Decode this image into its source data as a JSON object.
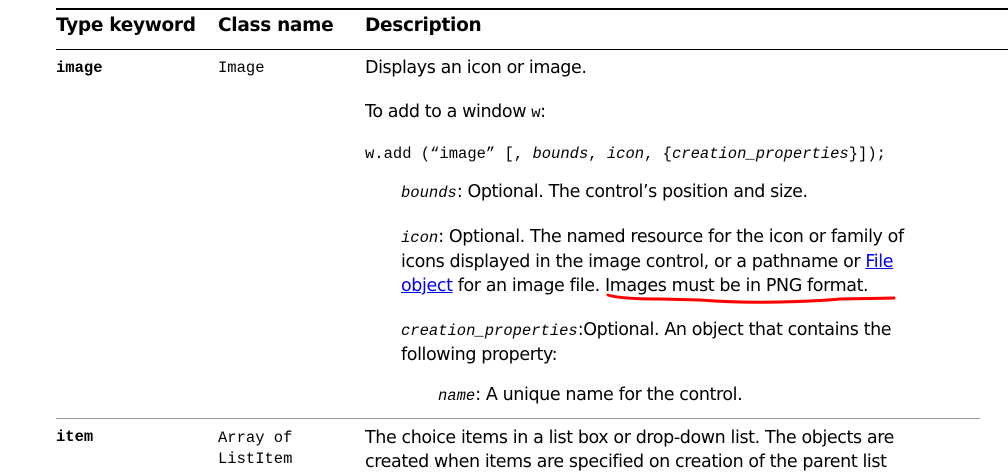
{
  "table": {
    "headers": [
      "Type keyword",
      "Class name",
      "Description"
    ],
    "rows": [
      {
        "keyword": "image",
        "class_name": "Image",
        "description": "Displays an icon or image.",
        "add_intro_pre": "To add to a window ",
        "add_intro_var": "w",
        "add_intro_post": ":",
        "code_pre": "w.add (“image” [, ",
        "code_bounds": "bounds",
        "code_sep1": ", ",
        "code_icon": "icon",
        "code_sep2": ", {",
        "code_cp": "creation_properties",
        "code_post": "}]);",
        "bounds_name": "bounds",
        "bounds_desc": ": Optional. The control’s position and size.",
        "icon_name": "icon",
        "icon_desc_line1": ": Optional. The named resource for the icon or family of",
        "icon_desc_line2": "icons displayed in the image control, or a pathname or ",
        "link_file": "File",
        "link_object": "object",
        "icon_desc_line3": " for an image file. ",
        "icon_desc_highlight": "Images must be in PNG format.",
        "cp_name": "creation_properties",
        "cp_desc_line1": ":Optional. An object that contains the",
        "cp_desc_line2": "following property:",
        "name_name": "name",
        "name_desc": ": A unique name for the control."
      },
      {
        "keyword": "item",
        "class_name_line1": "Array of",
        "class_name_line2": "ListItem",
        "description_line1": "The choice items in a list box or drop-down list. The objects are",
        "description_line2": "created when items are specified on creation of the parent list"
      }
    ]
  },
  "colors": {
    "link": "#0000ee",
    "annotation": "#ff0000"
  }
}
